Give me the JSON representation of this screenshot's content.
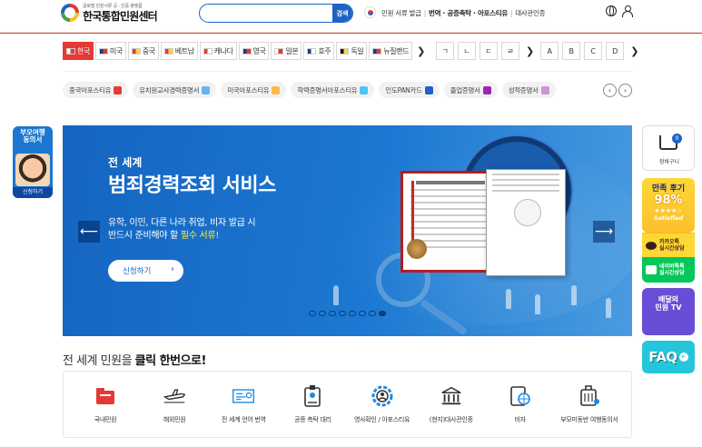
{
  "header": {
    "logo_sub": "글로벌 민원서류 공 · 인증 플랫폼",
    "logo_main": "한국통합민원센터",
    "search_placeholder": "",
    "search_button": "검색",
    "links": [
      "민원 서류 발급",
      "번역 · 공증촉탁 · 아포스티유",
      "대사관인증"
    ]
  },
  "countries": {
    "items": [
      {
        "label": "한국",
        "active": true,
        "flag": [
          "#ffffff",
          "#e53935"
        ]
      },
      {
        "label": "미국",
        "active": false,
        "flag": [
          "#1e3a8a",
          "#e53935"
        ]
      },
      {
        "label": "중국",
        "active": false,
        "flag": [
          "#e53935",
          "#fdd835"
        ]
      },
      {
        "label": "베트남",
        "active": false,
        "flag": [
          "#e53935",
          "#fdd835"
        ]
      },
      {
        "label": "캐나다",
        "active": false,
        "flag": [
          "#e53935",
          "#ffffff"
        ]
      },
      {
        "label": "영국",
        "active": false,
        "flag": [
          "#1e3a8a",
          "#e53935"
        ]
      },
      {
        "label": "일본",
        "active": false,
        "flag": [
          "#ffffff",
          "#e53935"
        ]
      },
      {
        "label": "호주",
        "active": false,
        "flag": [
          "#1e3a8a",
          "#ffffff"
        ]
      },
      {
        "label": "독일",
        "active": false,
        "flag": [
          "#111111",
          "#fdd835"
        ]
      },
      {
        "label": "뉴질랜드",
        "active": false,
        "flag": [
          "#1e3a8a",
          "#e53935"
        ]
      }
    ],
    "next": "❯",
    "letters_prev": "❯",
    "letters": [
      "ㄱ",
      "ㄴ",
      "ㄷ",
      "ㄹ"
    ],
    "letters_sep": "❯",
    "alpha": [
      "A",
      "B",
      "C",
      "D"
    ],
    "alpha_next": "❯"
  },
  "chips": [
    {
      "label": "중국아포스티유",
      "color": "#e53935"
    },
    {
      "label": "유치원교사경력증명서",
      "color": "#64b5f6"
    },
    {
      "label": "미국아포스티유",
      "color": "#ffb74d"
    },
    {
      "label": "학력증명서아포스티유",
      "color": "#4fc3f7"
    },
    {
      "label": "인도PAN카드",
      "color": "#1e63c4"
    },
    {
      "label": "졸업증명서",
      "color": "#9c27b0"
    },
    {
      "label": "성적증명서",
      "color": "#ce93d8"
    }
  ],
  "chip_nav": {
    "prev": "‹",
    "next": "›"
  },
  "banner": {
    "small": "전 세계",
    "title": "범죄경력조회 서비스",
    "line1": "유학, 이민, 다른 나라 취업, 비자 발급 시",
    "line2_pre": "반드시 준비해야 할 ",
    "line2_hl": "필수 서류!",
    "button": "신청하기",
    "button_chev": "›",
    "prev": "⟵",
    "next": "⟶",
    "dots": 8,
    "active_dot": 7
  },
  "section": {
    "title_pre": "전 세계 민원을 ",
    "title_bold": "클릭 한번으로",
    "title_post": "!"
  },
  "services": [
    {
      "label": "국내민원",
      "icon": "folder-icon",
      "color": "#e53935"
    },
    {
      "label": "해외민원",
      "icon": "airplane-icon",
      "color": "#333333"
    },
    {
      "label": "전 세계 언어 번역",
      "icon": "translate-icon",
      "color": "#1e88e5"
    },
    {
      "label": "공증 촉탁 대리",
      "icon": "id-badge-icon",
      "color": "#333333"
    },
    {
      "label": "영사확인 / 아포스티유",
      "icon": "gear-seal-icon",
      "color": "#1e88e5"
    },
    {
      "label": "(현지)대사관인증",
      "icon": "embassy-icon",
      "color": "#333333"
    },
    {
      "label": "비자",
      "icon": "visa-icon",
      "color": "#1e88e5"
    },
    {
      "label": "부모미동반 여행동의서",
      "icon": "luggage-icon",
      "color": "#333333"
    }
  ],
  "left_ad": {
    "title1": "부모여행",
    "title2": "동의서",
    "button": "신청하기"
  },
  "right_bar": {
    "cart_label": "장바구니",
    "cart_count": "0",
    "review_title": "만족 후기",
    "review_percent": "98%",
    "review_stars": "★★★★☆",
    "review_sub": "Satisfied",
    "kakao1": "카카오톡",
    "kakao2": "실시간상담",
    "naver1": "네이버톡톡",
    "naver2": "실시간상담",
    "tv1": "배달의",
    "tv2": "민원 TV",
    "faq": "FAQ",
    "faq_arrow": "▸"
  }
}
